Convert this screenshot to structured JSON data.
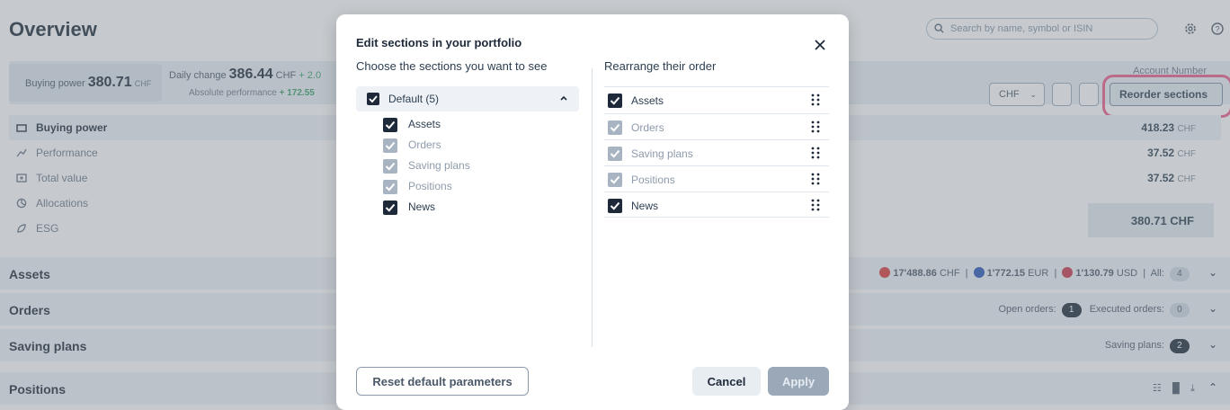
{
  "page": {
    "title": "Overview",
    "search_placeholder": "Search by name, symbol or ISIN",
    "summary": {
      "buying_power_label": "Buying power",
      "buying_power_value": "380.71",
      "buying_power_currency": "CHF",
      "daily_change_label": "Daily change",
      "daily_change_value": "386.44",
      "daily_change_currency": "CHF",
      "daily_change_pct": "+ 2.0",
      "abs_perf_label": "Absolute performance",
      "abs_perf_value": "+ 172.55",
      "account_label": "Account Number"
    },
    "controls": {
      "currency": "CHF",
      "reorder_label": "Reorder sections"
    },
    "menu": [
      {
        "label": "Buying power",
        "value": "418.23",
        "currency": "CHF",
        "icon": "wallet-icon"
      },
      {
        "label": "Performance",
        "value": "37.52",
        "currency": "CHF",
        "icon": "chart-line-icon"
      },
      {
        "label": "Total value",
        "value": "37.52",
        "currency": "CHF",
        "icon": "cash-icon"
      },
      {
        "label": "Allocations",
        "value": "",
        "currency": "",
        "icon": "pie-chart-icon"
      },
      {
        "label": "ESG",
        "value": "",
        "currency": "",
        "icon": "leaf-icon"
      }
    ],
    "total_value": "380.71 CHF",
    "sections": {
      "assets": {
        "label": "Assets",
        "chf": "17'488.86",
        "chf_cur": "CHF",
        "eur": "1'772.15",
        "eur_cur": "EUR",
        "usd": "1'130.79",
        "usd_cur": "USD",
        "all_label": "All:",
        "all_count": "4"
      },
      "orders": {
        "label": "Orders",
        "open_label": "Open orders:",
        "open_count": "1",
        "executed_label": "Executed orders:",
        "executed_count": "0"
      },
      "saving_plans": {
        "label": "Saving plans",
        "count_label": "Saving plans:",
        "count": "2"
      },
      "positions": {
        "label": "Positions"
      }
    }
  },
  "modal": {
    "title": "Edit sections in your portfolio",
    "left_heading": "Choose the sections you want to see",
    "right_heading": "Rearrange their order",
    "default_group": "Default (5)",
    "options": [
      {
        "label": "Assets",
        "checked": true,
        "locked": false
      },
      {
        "label": "Orders",
        "checked": true,
        "locked": true
      },
      {
        "label": "Saving plans",
        "checked": true,
        "locked": true
      },
      {
        "label": "Positions",
        "checked": true,
        "locked": true
      },
      {
        "label": "News",
        "checked": true,
        "locked": false
      }
    ],
    "order": [
      {
        "label": "Assets",
        "locked": false
      },
      {
        "label": "Orders",
        "locked": true
      },
      {
        "label": "Saving plans",
        "locked": true
      },
      {
        "label": "Positions",
        "locked": true
      },
      {
        "label": "News",
        "locked": false
      }
    ],
    "buttons": {
      "reset": "Reset default parameters",
      "cancel": "Cancel",
      "apply": "Apply"
    }
  },
  "colors": {
    "checkbox_dark": "#1e2a3a",
    "checkbox_dim": "#a8b4c2",
    "highlight": "#ec5a8a"
  }
}
